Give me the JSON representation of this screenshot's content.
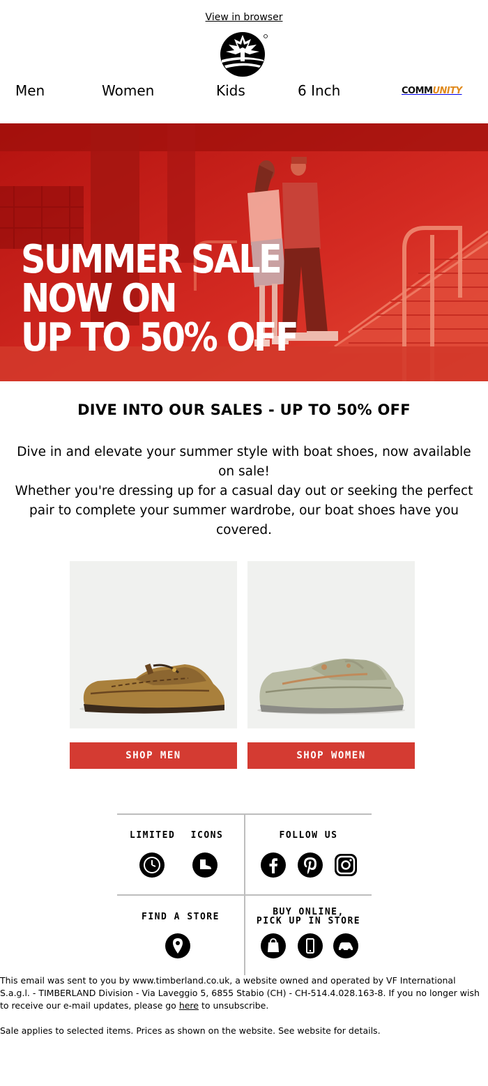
{
  "header": {
    "view_in_browser": "View in browser"
  },
  "nav": {
    "items": [
      {
        "label": "Men"
      },
      {
        "label": "Women"
      },
      {
        "label": "Kids"
      },
      {
        "label": "6 Inch"
      }
    ],
    "community_part1": "COMM",
    "community_part2": "UNITY"
  },
  "hero": {
    "line1": "SUMMER SALE",
    "line2": "NOW ON",
    "line3": "UP TO 50% OFF"
  },
  "main": {
    "headline": "DIVE INTO OUR SALES - UP TO 50% OFF",
    "paragraph1": "Dive in and elevate your summer style with boat shoes, now available on sale!",
    "paragraph2": "Whether you're dressing up for a casual day out or seeking the perfect pair to complete your summer wardrobe, our boat shoes have you covered."
  },
  "products": {
    "men_button": "SHOP MEN",
    "women_button": "SHOP WOMEN"
  },
  "footer": {
    "limited": "LIMITED",
    "icons": "ICONS",
    "follow_us": "FOLLOW US",
    "find_store": "FIND A STORE",
    "buy_online_line1": "BUY ONLINE,",
    "buy_online_line2": "PICK UP IN STORE"
  },
  "legal": {
    "text_before_link": "This email was sent to you by www.timberland.co.uk, a website owned and operated by VF International S.a.g.l. - TIMBERLAND Division - Via Laveggio 5, 6855 Stabio (CH) - CH-514.4.028.163-8. If you no longer wish to receive our e-mail updates, please go ",
    "link": "here",
    "text_after_link": " to unsubscribe.",
    "note": "Sale applies to selected items. Prices as shown on the website. See website for details."
  },
  "colors": {
    "hero_red": "#c71f1a",
    "button_red": "#d43b32",
    "community_orange": "#e08a1e",
    "divider_gray": "#bdbdbd"
  }
}
